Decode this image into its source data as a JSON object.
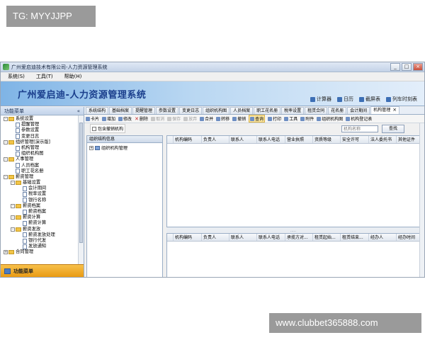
{
  "watermarks": {
    "top": "TG: MYYJJPP",
    "bottom": "www.clubbet365888.com"
  },
  "window": {
    "title": "广州爱启迪技术有限公司-人力资源管理系统",
    "buttons": [
      "_",
      "□",
      "×"
    ]
  },
  "menubar": [
    "系统(S)",
    "工具(T)",
    "帮助(H)"
  ],
  "banner": {
    "title": "广州爱启迪-人力资源管理系统",
    "quick_links": [
      "计算器",
      "日历",
      "截屏表",
      "列车时刻表"
    ]
  },
  "sidebar": {
    "title": "功能菜单",
    "collapse": "«",
    "footer": "功能菜单",
    "tree": [
      {
        "level": 0,
        "type": "folder",
        "exp": "-",
        "label": "系统设置"
      },
      {
        "level": 1,
        "type": "doc",
        "label": "提醒管理"
      },
      {
        "level": 1,
        "type": "doc",
        "label": "参数设置"
      },
      {
        "level": 1,
        "type": "doc",
        "label": "变更日志"
      },
      {
        "level": 0,
        "type": "folder",
        "exp": "-",
        "label": "组织管理[演示版]"
      },
      {
        "level": 1,
        "type": "doc",
        "label": "机构管理"
      },
      {
        "level": 1,
        "type": "doc",
        "label": "组织机构图"
      },
      {
        "level": 0,
        "type": "folder",
        "exp": "-",
        "label": "人事管理"
      },
      {
        "level": 1,
        "type": "doc",
        "label": "人员档案"
      },
      {
        "level": 1,
        "type": "doc",
        "label": "职工花名册"
      },
      {
        "level": 0,
        "type": "folder",
        "exp": "-",
        "label": "薪资管理"
      },
      {
        "level": 1,
        "type": "folder",
        "exp": "-",
        "label": "基础设置"
      },
      {
        "level": 2,
        "type": "doc",
        "label": "会计期间"
      },
      {
        "level": 2,
        "type": "doc",
        "label": "税率设置"
      },
      {
        "level": 2,
        "type": "doc",
        "label": "银行名称"
      },
      {
        "level": 1,
        "type": "folder",
        "exp": "-",
        "label": "薪资档案"
      },
      {
        "level": 2,
        "type": "doc",
        "label": "薪资档案"
      },
      {
        "level": 1,
        "type": "folder",
        "exp": "-",
        "label": "薪资计算"
      },
      {
        "level": 2,
        "type": "doc",
        "label": "薪资计算"
      },
      {
        "level": 1,
        "type": "folder",
        "exp": "-",
        "label": "薪资发放"
      },
      {
        "level": 2,
        "type": "doc",
        "label": "薪资发放处理"
      },
      {
        "level": 2,
        "type": "doc",
        "label": "银行代发"
      },
      {
        "level": 2,
        "type": "doc",
        "label": "发放通知"
      },
      {
        "level": 0,
        "type": "folder",
        "exp": "+",
        "label": "合同管理"
      }
    ]
  },
  "tabs": [
    {
      "label": "系统结构",
      "active": false
    },
    {
      "label": "基础档案",
      "active": false
    },
    {
      "label": "提醒管理",
      "active": false
    },
    {
      "label": "参数设置",
      "active": false
    },
    {
      "label": "变更日志",
      "active": false
    },
    {
      "label": "组织机构图",
      "active": false
    },
    {
      "label": "人员档案",
      "active": false
    },
    {
      "label": "职工花名册",
      "active": false
    },
    {
      "label": "税率设置",
      "active": false
    },
    {
      "label": "租赁合同",
      "active": false
    },
    {
      "label": "花名册",
      "active": false
    },
    {
      "label": "会计期间",
      "active": false
    },
    {
      "label": "机构管理",
      "active": true
    }
  ],
  "tab_close": "×",
  "toolbar": [
    {
      "label": "卡片",
      "state": "normal"
    },
    {
      "label": "增加",
      "state": "normal"
    },
    {
      "label": "修改",
      "state": "normal"
    },
    {
      "label": "删除",
      "state": "delete"
    },
    {
      "label": "取消",
      "state": "disabled"
    },
    {
      "label": "保存",
      "state": "disabled"
    },
    {
      "label": "放弃",
      "state": "disabled"
    },
    {
      "label": "合并",
      "state": "normal"
    },
    {
      "label": "转移",
      "state": "normal"
    },
    {
      "label": "撤销",
      "state": "normal"
    },
    {
      "label": "查询",
      "state": "highlight"
    },
    {
      "label": "打印",
      "state": "normal"
    },
    {
      "label": "工具",
      "state": "normal"
    },
    {
      "label": "附件",
      "state": "normal"
    },
    {
      "label": "组织机构图",
      "state": "normal"
    },
    {
      "label": "机构登记表",
      "state": "normal"
    }
  ],
  "filter": {
    "checkbox_label": "包含撤销机构",
    "search_placeholder": "机构名称",
    "search_button": "查找"
  },
  "org_panel": {
    "title": "组织结构信息",
    "root": "组织机构管理",
    "root_exp": "+"
  },
  "grid_top": {
    "columns": [
      "机构编码",
      "负责人",
      "联系人",
      "联系人电话",
      "营业执照",
      "资质等级",
      "安全许可",
      "法人委托书",
      "其他证件"
    ]
  },
  "grid_bottom": {
    "columns": [
      "机构编码",
      "负责人",
      "联系人",
      "联系人电话",
      "承揽方对...",
      "租赁起始...",
      "租赁结束...",
      "经办人",
      "经办时间"
    ]
  },
  "splitter_dots": "....."
}
